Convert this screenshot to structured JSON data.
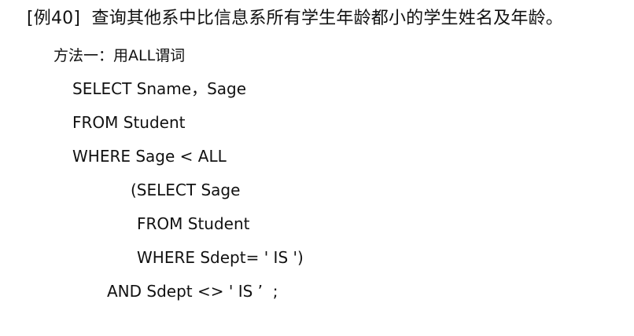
{
  "example": {
    "title": "[例40]  查询其他系中比信息系所有学生年龄都小的学生姓名及年龄。",
    "method": "方法一：用ALL谓词",
    "sql_lines": [
      "SELECT Sname，Sage",
      "FROM Student",
      "WHERE Sage < ALL",
      "(SELECT Sage",
      "FROM Student",
      "WHERE Sdept= ' IS ')",
      "AND Sdept <> ' IS ’  ;"
    ]
  }
}
